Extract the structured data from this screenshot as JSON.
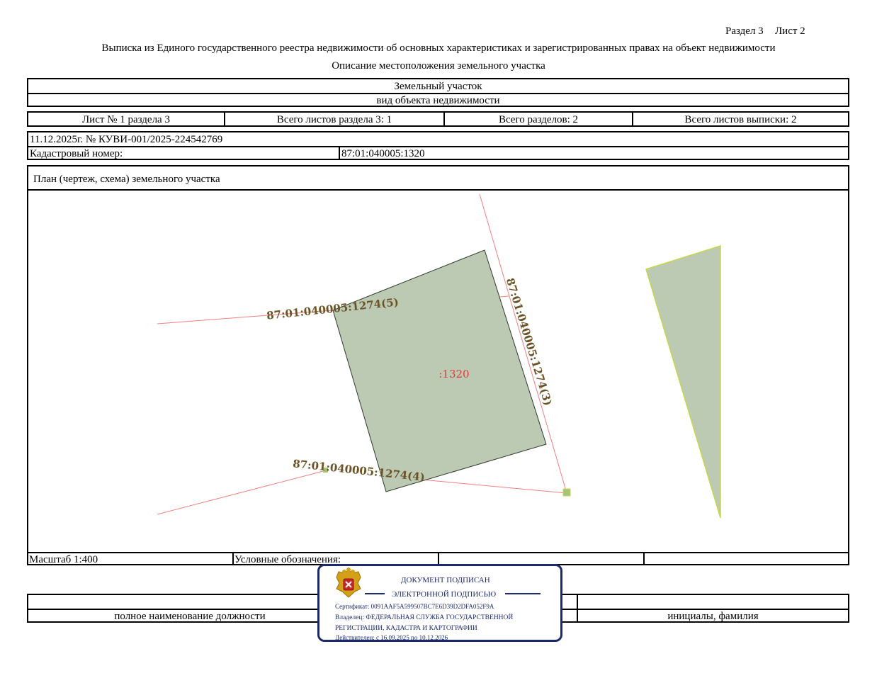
{
  "header": {
    "section": "Раздел 3",
    "sheet": "Лист 2",
    "title": "Выписка из Единого государственного реестра недвижимости об основных характеристиках и зарегистрированных правах на объект недвижимости",
    "subtitle": "Описание местоположения земельного участка"
  },
  "object": {
    "type_value": "Земельный участок",
    "type_caption": "вид объекта недвижимости"
  },
  "sheets_row": {
    "sheet_of_section": "Лист № 1 раздела 3",
    "total_sheets_section": "Всего листов раздела 3: 1",
    "total_sections": "Всего разделов: 2",
    "total_sheets_extract": "Всего листов выписки: 2"
  },
  "document": {
    "date_number": "11.12.2025г. № КУВИ-001/2025-224542769",
    "cadastral_label": "Кадастровый номер:",
    "cadastral_number": "87:01:040005:1320"
  },
  "plan": {
    "title": "План (чертеж, схема) земельного участка",
    "parcel_label": ":1320",
    "neighbor_5": "87:01:040005:1274(5)",
    "neighbor_3": "87:01:040005:1274(3)",
    "neighbor_4": "87:01:040005:1274(4)",
    "parcel_fill": "#bcc9b3",
    "line_color": "#f08080",
    "label_color": "#6b5326"
  },
  "footer": {
    "scale": "Масштаб 1:400",
    "legend_label": "Условные обозначения:",
    "position_caption": "полное наименование должности",
    "name_caption": "инициалы, фамилия"
  },
  "stamp": {
    "line1": "ДОКУМЕНТ ПОДПИСАН",
    "line2": "ЭЛЕКТРОННОЙ ПОДПИСЬЮ",
    "certificate": "Сертификат: 0091AAF5A599507BC7E6D39D2DFA052F9A",
    "owner_line1": "Владелец: ФЕДЕРАЛЬНАЯ СЛУЖБА ГОСУДАРСТВЕННОЙ",
    "owner_line2": "РЕГИСТРАЦИИ, КАДАСТРА И КАРТОГРАФИИ",
    "valid": "Действителен: с 16.09.2025 по 10.12.2026",
    "color": "#1a2a6c"
  }
}
